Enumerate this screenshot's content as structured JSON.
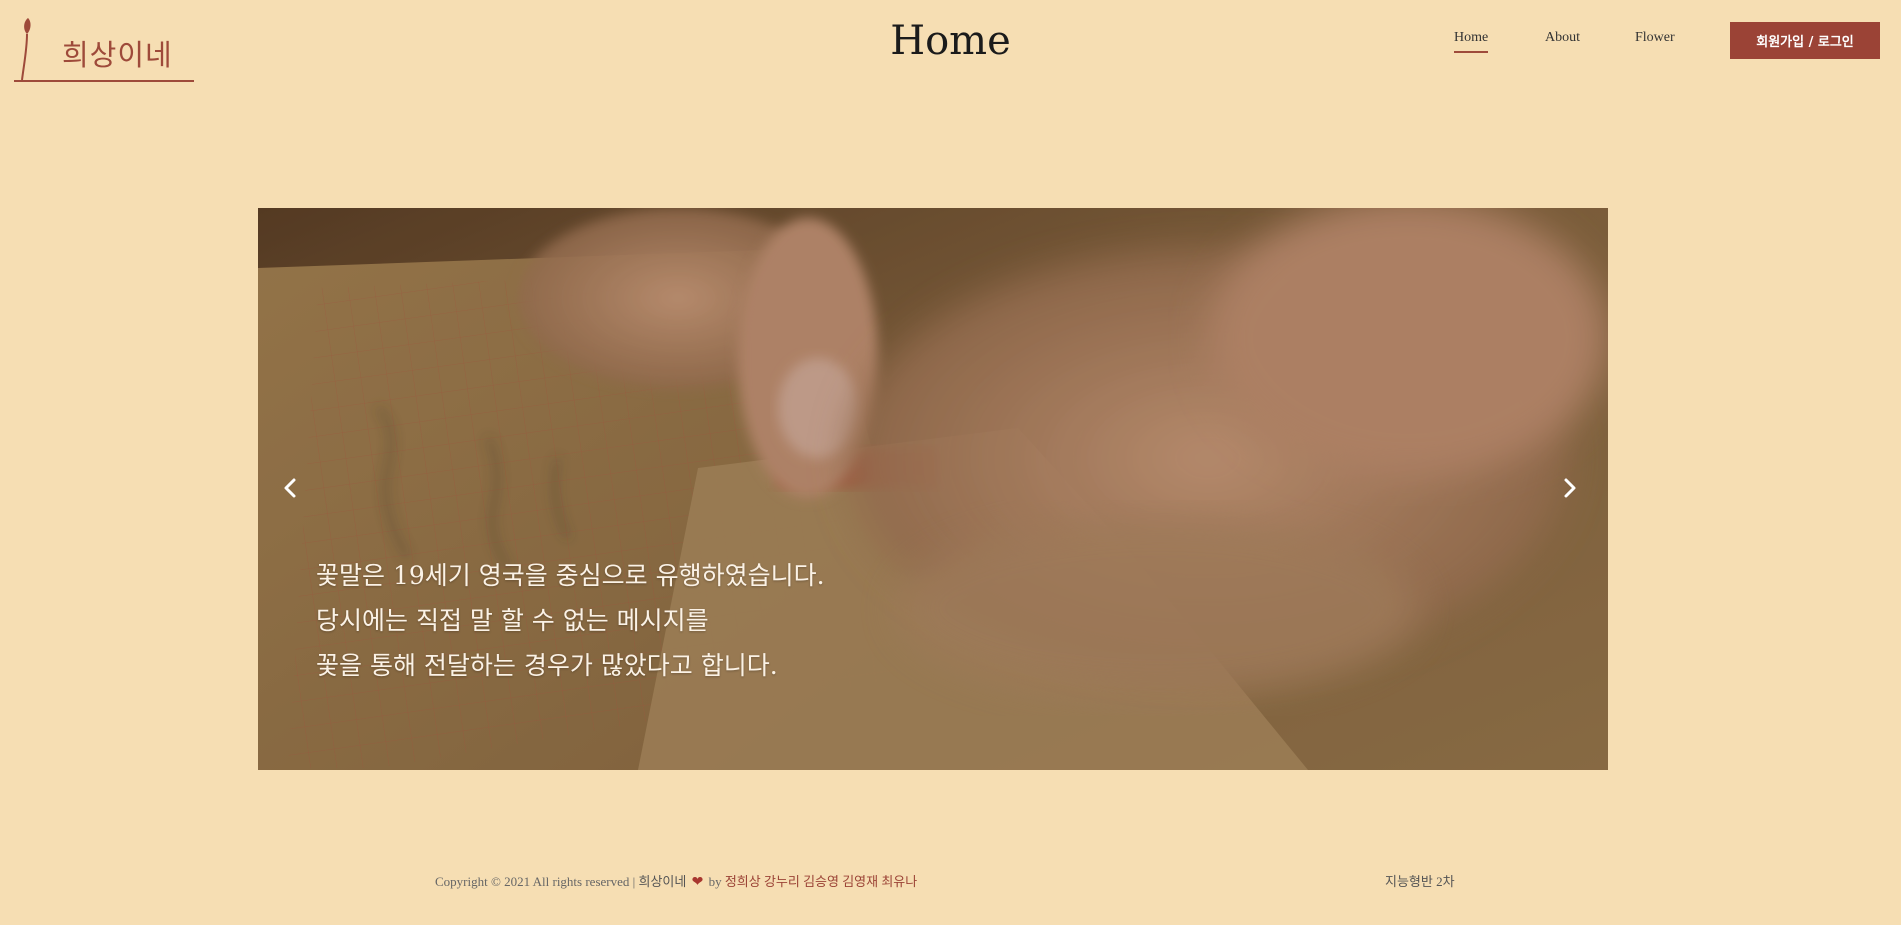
{
  "header": {
    "logo_text": "희상이네",
    "page_title": "Home",
    "nav": [
      {
        "label": "Home",
        "active": true
      },
      {
        "label": "About",
        "active": false
      },
      {
        "label": "Flower",
        "active": false
      }
    ],
    "join_button": "회원가입 / 로그인"
  },
  "carousel": {
    "caption_lines": [
      "꽃말은 19세기 영국을 중심으로 유행하였습니다.",
      "당시에는 직접 말 할 수 없는 메시지를",
      "꽃을 통해 전달하는 경우가 많았다고 합니다."
    ],
    "prev_icon": "chevron-left-icon",
    "next_icon": "chevron-right-icon"
  },
  "footer": {
    "copyright": "Copyright © 2021 All rights reserved |",
    "brand": "희상이네",
    "heart": "❤",
    "by": "by",
    "names": "정희상 강누리 김승영 김영재 최유나",
    "right_text": "지능형반 2차"
  },
  "colors": {
    "background": "#f6deb3",
    "accent": "#9b4336"
  }
}
